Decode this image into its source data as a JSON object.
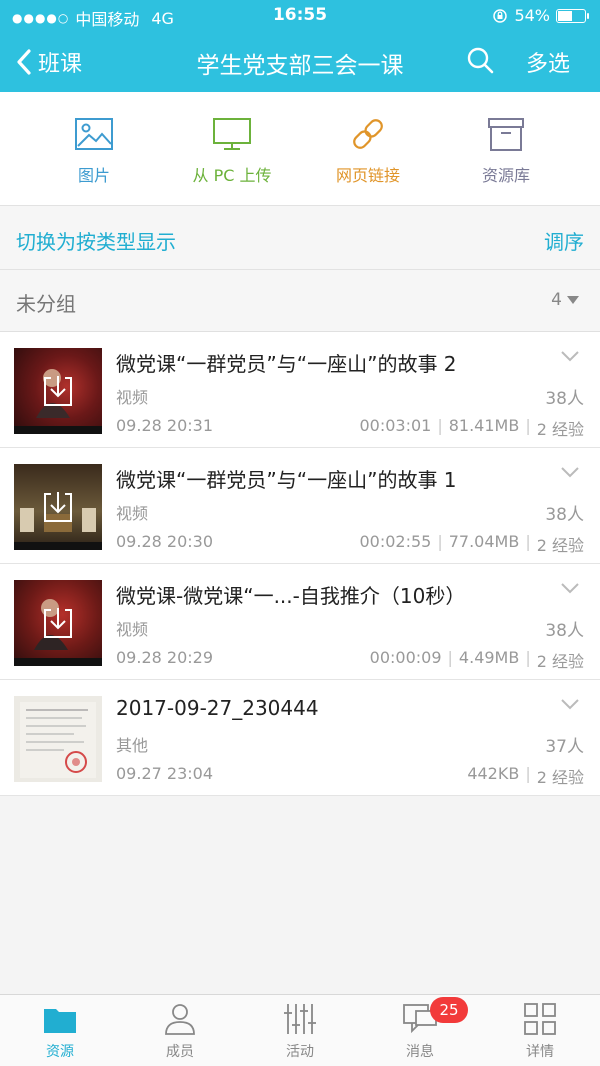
{
  "status": {
    "carrier": "中国移动",
    "network": "4G",
    "time": "16:55",
    "battery": "54%",
    "battery_level": 0.54
  },
  "nav": {
    "back_label": "班课",
    "title": "学生党支部三会一课",
    "multi_select": "多选"
  },
  "upload": {
    "items": [
      {
        "label": "图片",
        "color": "#3d9bd0",
        "icon": "image-icon"
      },
      {
        "label": "从 PC 上传",
        "color": "#6cb23b",
        "icon": "monitor-icon"
      },
      {
        "label": "网页链接",
        "color": "#e0952a",
        "icon": "link-icon"
      },
      {
        "label": "资源库",
        "color": "#7a7a96",
        "icon": "archive-box-icon"
      }
    ]
  },
  "section": {
    "switch_label": "切换为按类型显示",
    "order_label": "调序"
  },
  "group": {
    "name": "未分组",
    "count": "4"
  },
  "resources": [
    {
      "title": "微党课“一群党员”与“一座山”的故事 2",
      "type": "视频",
      "date": "09.28 20:31",
      "people": "38人",
      "duration": "00:03:01",
      "size": "81.41MB",
      "exp": "2 经验"
    },
    {
      "title": "微党课“一群党员”与“一座山”的故事 1",
      "type": "视频",
      "date": "09.28 20:30",
      "people": "38人",
      "duration": "00:02:55",
      "size": "77.04MB",
      "exp": "2 经验"
    },
    {
      "title": "微党课-微党课“一...-自我推介（10秒）",
      "type": "视频",
      "date": "09.28 20:29",
      "people": "38人",
      "duration": "00:00:09",
      "size": "4.49MB",
      "exp": "2 经验"
    },
    {
      "title": "2017-09-27_230444",
      "type": "其他",
      "date": "09.27 23:04",
      "people": "37人",
      "size": "442KB",
      "exp": "2 经验"
    }
  ],
  "tabs": [
    {
      "label": "资源",
      "icon": "folder-icon"
    },
    {
      "label": "成员",
      "icon": "person-icon"
    },
    {
      "label": "活动",
      "icon": "sliders-icon"
    },
    {
      "label": "消息",
      "icon": "chat-icon",
      "badge": "25"
    },
    {
      "label": "详情",
      "icon": "grid-icon"
    }
  ],
  "colors": {
    "accent": "#2ec1df",
    "link": "#21aed1",
    "badge": "#f23a3a"
  }
}
